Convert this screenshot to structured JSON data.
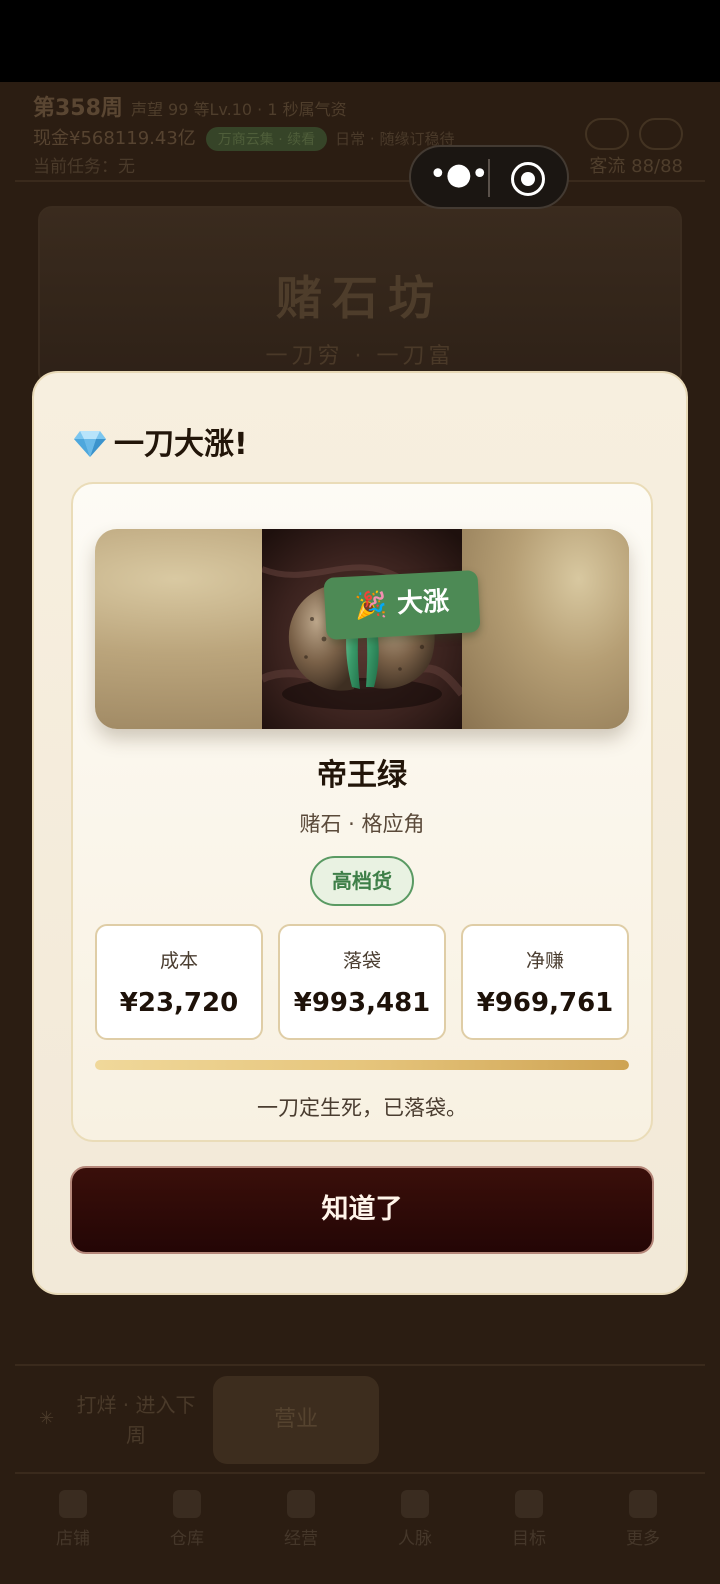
{
  "background": {
    "header": {
      "week": "第358周",
      "line1_rest": "声望 99  等Lv.10  · 1 秒属气资",
      "cash": "现金¥568119.43亿",
      "chip": "万商云集 · 续看",
      "line2_rest": "日常 · 随缘订稳待",
      "task": "当前任务：无",
      "spots": "客流 88/88"
    },
    "banner": {
      "title": "赌石坊",
      "subtitle": "一刀穷 · 一刀富"
    },
    "actions": {
      "left_label": "打烊 · 进入下周",
      "main_button": "营业"
    },
    "tabs": [
      {
        "label": "店铺",
        "icon": "shop-icon"
      },
      {
        "label": "仓库",
        "icon": "warehouse-icon"
      },
      {
        "label": "经营",
        "icon": "business-icon"
      },
      {
        "label": "人脉",
        "icon": "people-icon"
      },
      {
        "label": "目标",
        "icon": "target-icon"
      },
      {
        "label": "更多",
        "icon": "more-icon"
      }
    ]
  },
  "capsule": {
    "menu_icon": "more-dots-icon",
    "close_icon": "miniprogram-close-icon"
  },
  "modal": {
    "title": "一刀大涨!",
    "title_icon": "gem-icon",
    "tag": {
      "emoji": "🎉",
      "label": "大涨",
      "color": "#4d8a55"
    },
    "item": {
      "name": "帝王绿",
      "meta": "赌石 · 格应角",
      "grade": "高档货",
      "image": "jade-stone-photo"
    },
    "stats": [
      {
        "key": "成本",
        "value": "¥23,720"
      },
      {
        "key": "落袋",
        "value": "¥993,481"
      },
      {
        "key": "净赚",
        "value": "¥969,761"
      }
    ],
    "progress": 1.0,
    "footnote": "一刀定生死，已落袋。",
    "confirm_button": "知道了"
  },
  "colors": {
    "accent_green": "#4d8a55",
    "button_dark": "#2a0807",
    "card_cream": "#f7efdf",
    "gold": "#cea353"
  }
}
